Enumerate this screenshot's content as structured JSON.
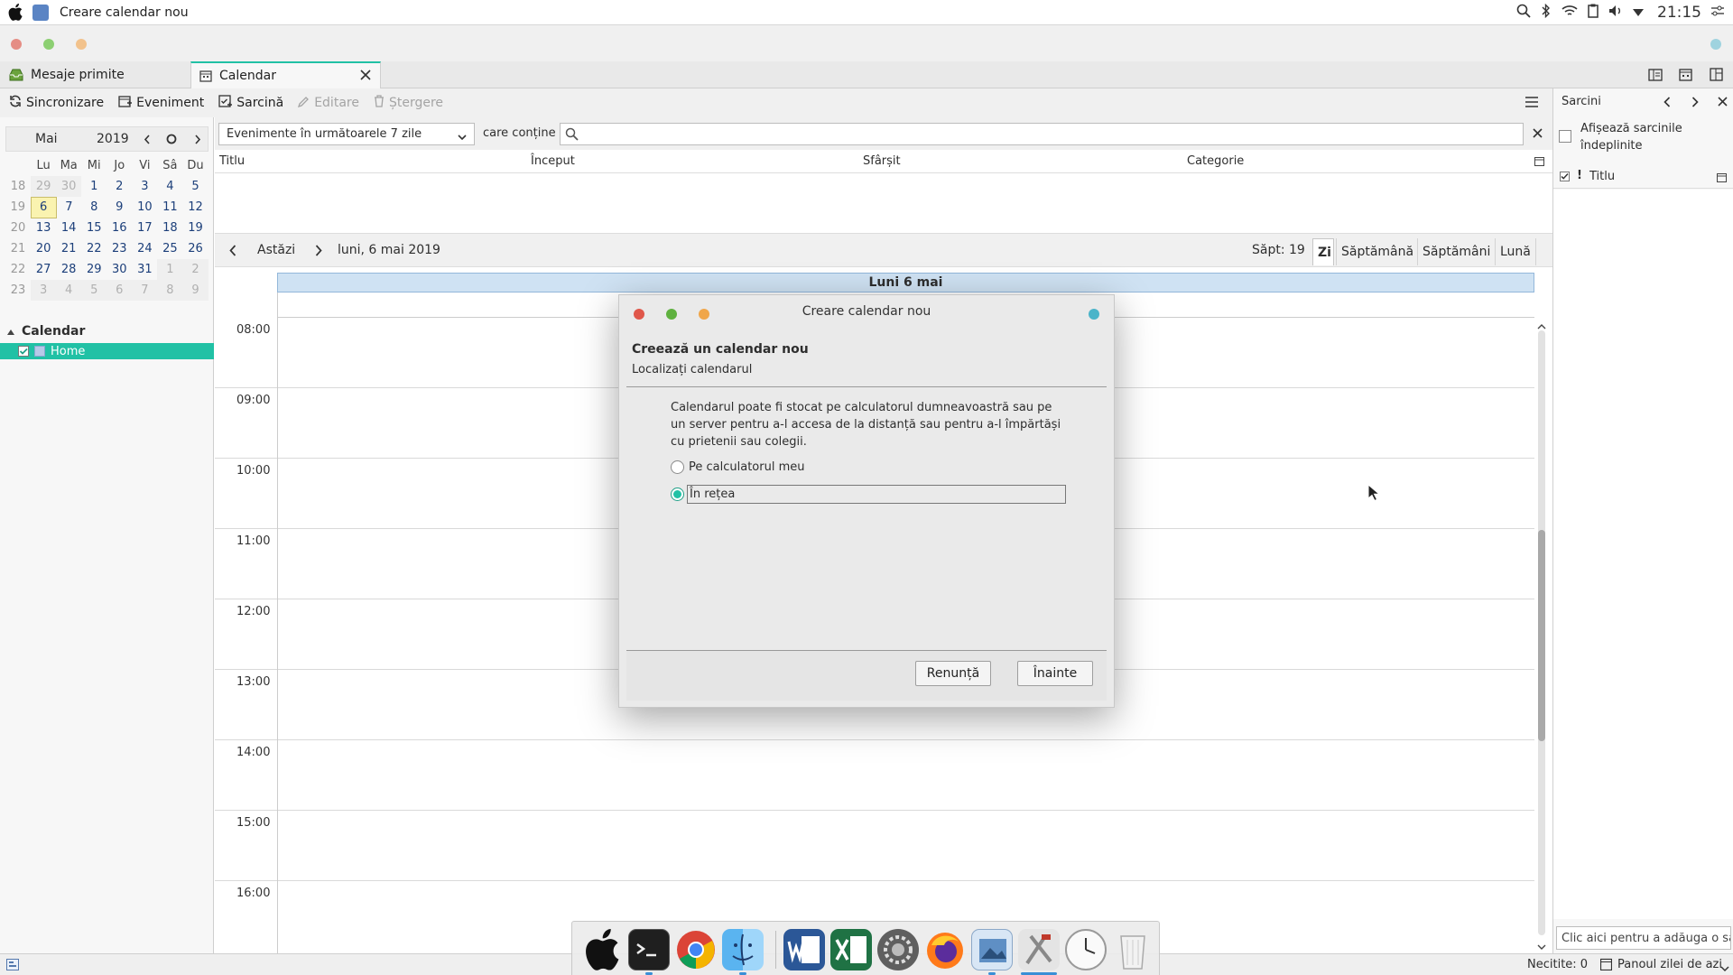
{
  "system": {
    "window_title": "Creare calendar nou",
    "clock": "21:15"
  },
  "tabs": [
    {
      "label": "Mesaje primite"
    },
    {
      "label": "Calendar"
    }
  ],
  "toolbar": {
    "sync": "Sincronizare",
    "event": "Eveniment",
    "task": "Sarcină",
    "edit": "Editare",
    "delete": "Ștergere"
  },
  "mini_calendar": {
    "month": "Mai",
    "year": "2019",
    "weekdays": [
      "Lu",
      "Ma",
      "Mi",
      "Jo",
      "Vi",
      "Sâ",
      "Du"
    ],
    "weeks": [
      {
        "wk": "18",
        "days": [
          "29",
          "30",
          "1",
          "2",
          "3",
          "4",
          "5"
        ]
      },
      {
        "wk": "19",
        "days": [
          "6",
          "7",
          "8",
          "9",
          "10",
          "11",
          "12"
        ]
      },
      {
        "wk": "20",
        "days": [
          "13",
          "14",
          "15",
          "16",
          "17",
          "18",
          "19"
        ]
      },
      {
        "wk": "21",
        "days": [
          "20",
          "21",
          "22",
          "23",
          "24",
          "25",
          "26"
        ]
      },
      {
        "wk": "22",
        "days": [
          "27",
          "28",
          "29",
          "30",
          "31",
          "1",
          "2"
        ]
      },
      {
        "wk": "23",
        "days": [
          "3",
          "4",
          "5",
          "6",
          "7",
          "8",
          "9"
        ]
      }
    ]
  },
  "calendars": {
    "heading": "Calendar",
    "items": [
      {
        "name": "Home"
      }
    ]
  },
  "filter": {
    "range_selected": "Evenimente în următoarele 7 zile",
    "contains_label": "care conține",
    "search_value": ""
  },
  "event_table": {
    "columns": [
      "Titlu",
      "Început",
      "Sfârșit",
      "Categorie"
    ]
  },
  "day_nav": {
    "today": "Astăzi",
    "date": "luni, 6 mai 2019",
    "week": "Săpt: 19",
    "views": [
      "Zi",
      "Săptămână",
      "Săptămâni",
      "Lună"
    ],
    "day_header": "Luni 6 mai"
  },
  "hours": [
    "08:00",
    "09:00",
    "10:00",
    "11:00",
    "12:00",
    "13:00",
    "14:00",
    "15:00",
    "16:00"
  ],
  "tasks_pane": {
    "title": "Sarcini",
    "show_completed": "Afișează sarcinile îndeplinite",
    "column_title": "Titlu",
    "add_placeholder": "Clic aici pentru a adăuga o sarc"
  },
  "status": {
    "unread": "Necitite: 0",
    "today_pane": "Panoul zilei de azi"
  },
  "dialog": {
    "title": "Creare calendar nou",
    "heading": "Creează un calendar nou",
    "subheading": "Localizați calendarul",
    "description": "Calendarul poate fi stocat pe calculatorul dumneavoastră sau pe un server pentru a-l accesa de la distanță sau pentru a-l împărtăși cu prietenii sau colegii.",
    "option_local": "Pe calculatorul meu",
    "option_network": "În rețea",
    "selected": "network",
    "cancel": "Renunță",
    "next": "Înainte"
  },
  "colors": {
    "accent": "#21c1a5",
    "close_dot": "#e0574a",
    "min_dot": "#5fb13f",
    "max_dot": "#f0a64a",
    "extra_dot": "#4bb4c9"
  }
}
